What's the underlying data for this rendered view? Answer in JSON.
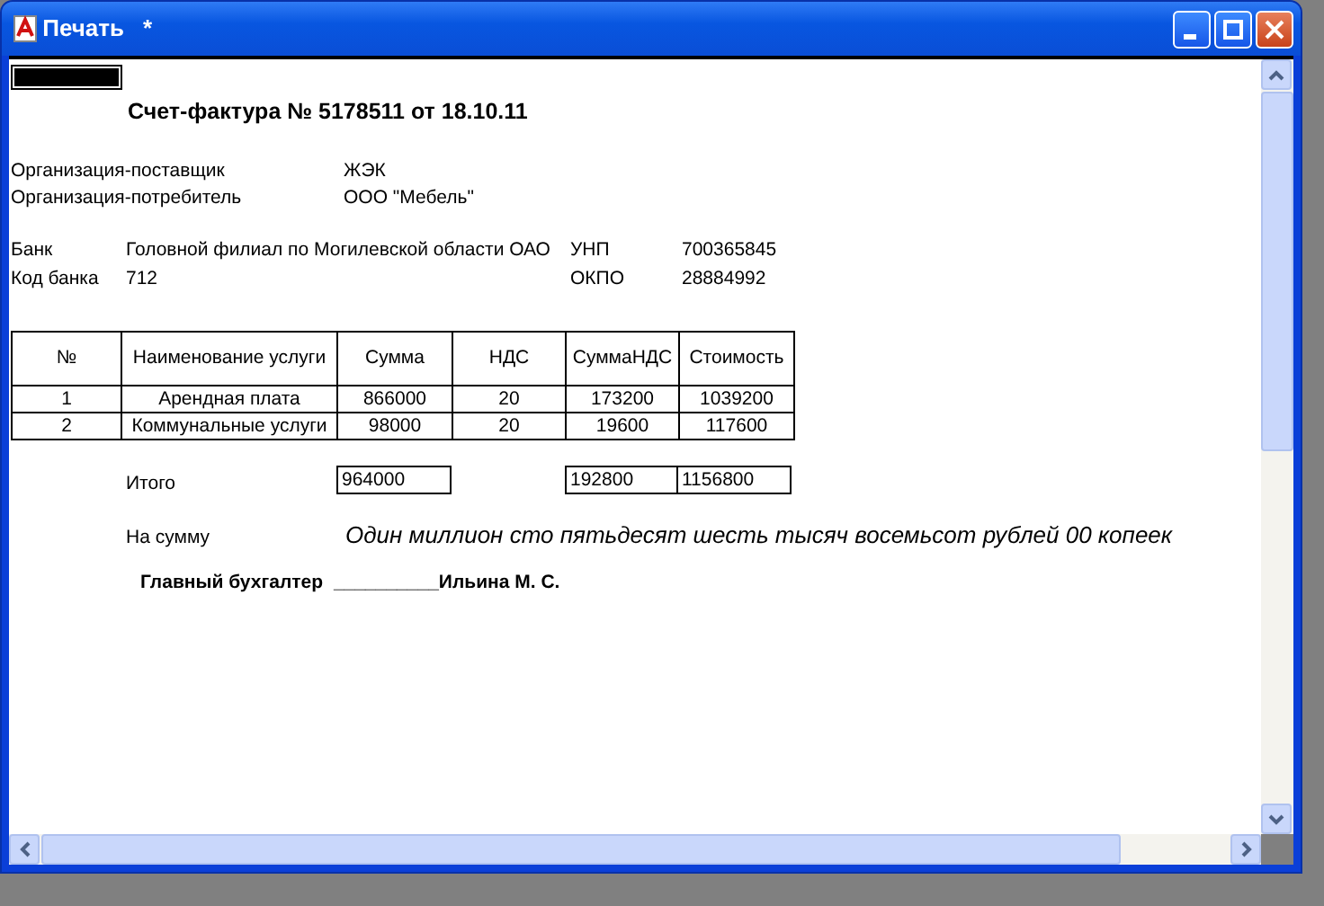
{
  "window": {
    "title": "Печать",
    "modified_mark": "*"
  },
  "document": {
    "title": "Счет-фактура № 5178511 от 18.10.11",
    "parties": [
      {
        "label": "Организация-поставщик",
        "value": "ЖЭК"
      },
      {
        "label": "Организация-потребитель",
        "value": "ООО \"Мебель\""
      }
    ],
    "bank_rows": [
      {
        "label": "Банк",
        "value": "Головной филиал по Могилевской области ОАО",
        "code_label": "УНП",
        "code_value": "700365845"
      },
      {
        "label": "Код банка",
        "value": "712",
        "code_label": "ОКПО",
        "code_value": "28884992"
      }
    ],
    "table": {
      "columns": [
        "№",
        "Наименование услуги",
        "Сумма",
        "НДС",
        "СуммаНДС",
        "Стоимость"
      ],
      "rows": [
        [
          "1",
          "Арендная плата",
          "866000",
          "20",
          "173200",
          "1039200"
        ],
        [
          "2",
          "Коммунальные услуги",
          "98000",
          "20",
          "19600",
          "117600"
        ]
      ]
    },
    "totals": {
      "label": "Итого",
      "sum": "964000",
      "vat_sum": "192800",
      "cost": "1156800"
    },
    "amount": {
      "label": "На сумму",
      "text": "Один миллион сто пятьдесят шесть тысяч восемьсот рублей 00 копеек"
    },
    "signature": {
      "label": "Главный бухгалтер",
      "line": "__________",
      "name": "Ильина М. С."
    }
  }
}
